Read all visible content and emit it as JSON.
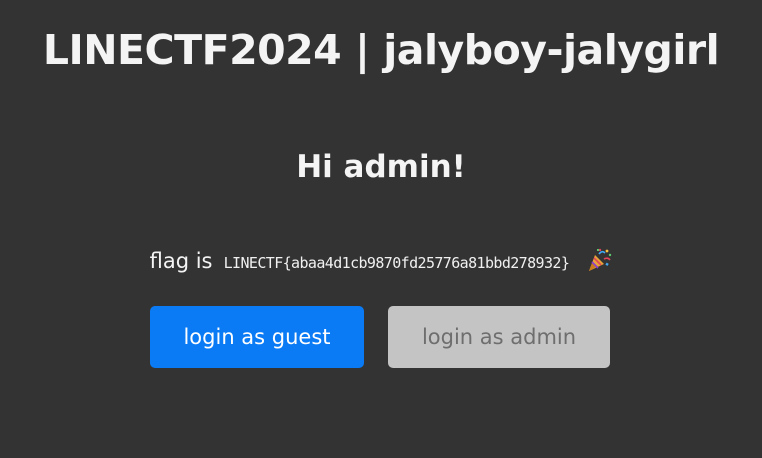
{
  "header": {
    "title": "LINECTF2024 | jalyboy-jalygirl"
  },
  "main": {
    "greeting": "Hi admin!",
    "flag_label": "flag is",
    "flag_value": "LINECTF{abaa4d1cb9870fd25776a81bbd278932}",
    "flag_icon": "party-popper-icon"
  },
  "actions": {
    "guest_label": "login as guest",
    "admin_label": "login as admin",
    "guest_color": "#0a7bf5",
    "admin_color": "#c4c4c4"
  }
}
